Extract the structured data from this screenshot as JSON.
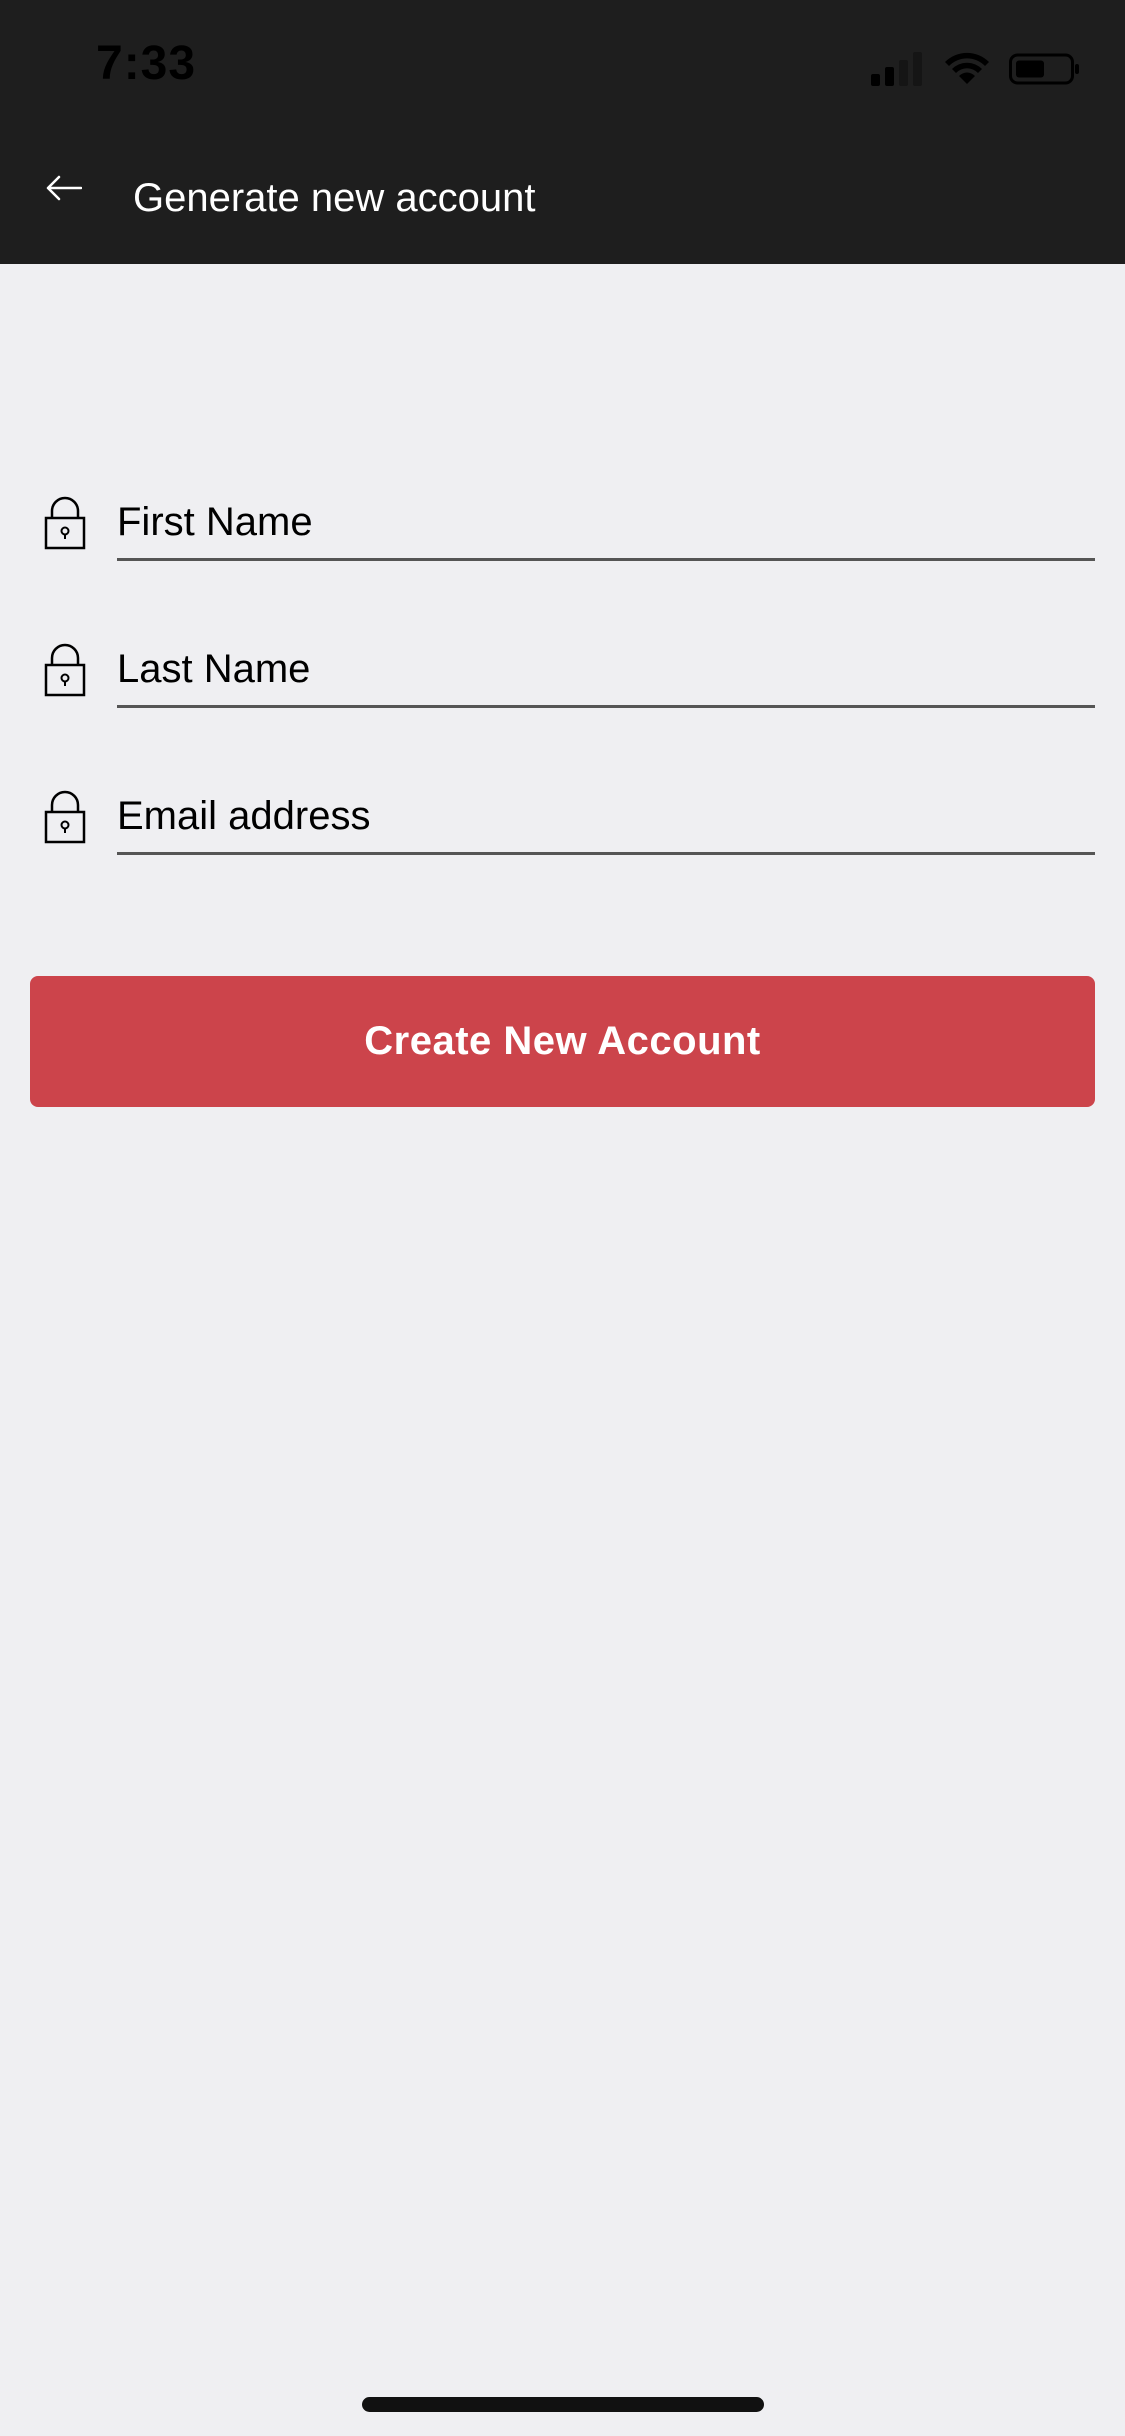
{
  "status_bar": {
    "time": "7:33"
  },
  "header": {
    "title": "Generate new account",
    "back_icon": "arrow-left-icon"
  },
  "form": {
    "fields": [
      {
        "placeholder": "First Name",
        "icon": "lock-icon"
      },
      {
        "placeholder": "Last Name",
        "icon": "lock-icon"
      },
      {
        "placeholder": "Email address",
        "icon": "lock-icon"
      }
    ]
  },
  "actions": {
    "create_label": "Create New Account"
  },
  "colors": {
    "header_bg": "#1e1e1e",
    "page_bg": "#efeff2",
    "accent": "#cc444b"
  }
}
